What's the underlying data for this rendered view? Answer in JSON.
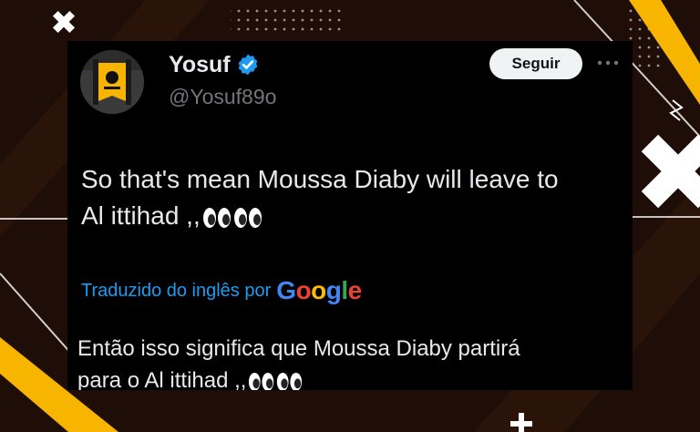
{
  "colors": {
    "background": "#1e0e07",
    "accent_yellow": "#f7b500",
    "card": "#000000",
    "link_blue": "#1d9bf0",
    "verified_blue": "#1d9bf0",
    "text_primary": "#e7e9ea",
    "text_secondary": "#71767b"
  },
  "tweet": {
    "author": {
      "display_name": "Yosuf",
      "handle": "@Yosuf89o",
      "verified": true,
      "verified_icon": "verified-badge-icon",
      "avatar_icon": "ittihad-flag-avatar"
    },
    "follow_label": "Seguir",
    "more_icon": "more-dots-icon",
    "text_line_1": "So that's mean Moussa Diaby will leave to",
    "text_line_2": "Al ittihad ,,",
    "text_emoji": "eyes-emoji",
    "translated_by_label": "Traduzido do inglês por",
    "translator_logo": "Google",
    "translation_line_1": "Então isso significa que Moussa Diaby partirá",
    "translation_line_2": "para o Al ittihad ,,",
    "translation_emoji": "eyes-emoji"
  }
}
